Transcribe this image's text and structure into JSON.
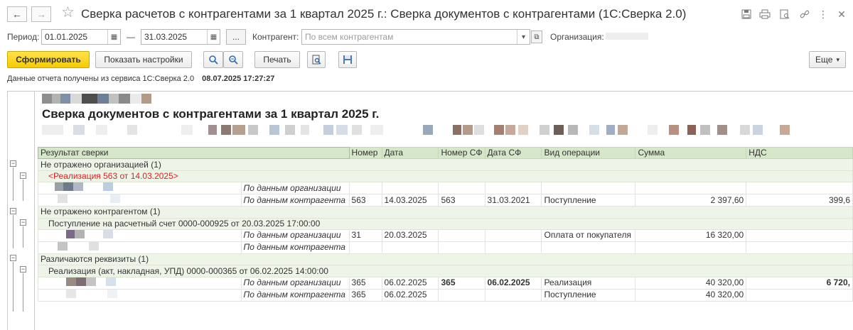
{
  "window": {
    "title": "Сверка расчетов с контрагентами за 1 квартал 2025 г.: Сверка документов с контрагентами (1С:Сверка 2.0)",
    "back_icon": "arrow-left-icon",
    "forward_icon": "arrow-right-icon",
    "favorite_icon": "star-icon",
    "tools": [
      "save-icon",
      "print-icon",
      "preview-icon",
      "link-icon",
      "more-icon",
      "close-icon"
    ]
  },
  "filters": {
    "period_label": "Период:",
    "date_from": "01.01.2025",
    "dash": "—",
    "date_to": "31.03.2025",
    "ellipsis": "...",
    "counterparty_label": "Контрагент:",
    "counterparty_placeholder": "По всем контрагентам",
    "organization_label": "Организация:"
  },
  "toolbar": {
    "generate": "Сформировать",
    "show_settings": "Показать настройки",
    "print": "Печать",
    "more": "Еще"
  },
  "status": {
    "text": "Данные отчета получены из сервиса 1С:Сверка 2.0",
    "timestamp": "08.07.2025 17:27:27"
  },
  "report": {
    "title": "Сверка документов с контрагентами за 1 квартал 2025 г.",
    "columns": [
      "Результат сверки",
      "Номер",
      "Дата",
      "Номер СФ",
      "Дата СФ",
      "Вид операции",
      "Сумма",
      "НДС"
    ],
    "groups": [
      {
        "label": "Не отражено организацией (1)",
        "document": "<Реализация 563 от 14.03.2025>",
        "rows": [
          {
            "source": "По данным организации",
            "number": "",
            "date": "",
            "sf_number": "",
            "sf_date": "",
            "operation": "",
            "sum": "",
            "vat": ""
          },
          {
            "source": "По данным контрагента",
            "number": "563",
            "date": "14.03.2025",
            "sf_number": "563",
            "sf_date": "31.03.2021",
            "operation": "Поступление",
            "sum": "2 397,60",
            "vat": "399,6"
          }
        ]
      },
      {
        "label": "Не отражено контрагентом (1)",
        "document": "Поступление на расчетный счет 0000-000925 от 20.03.2025 17:00:00",
        "rows": [
          {
            "source": "По данным организации",
            "number": "31",
            "date": "20.03.2025",
            "sf_number": "",
            "sf_date": "",
            "operation": "Оплата от покупателя",
            "sum": "16 320,00",
            "vat": ""
          },
          {
            "source": "По данным контрагента",
            "number": "",
            "date": "",
            "sf_number": "",
            "sf_date": "",
            "operation": "",
            "sum": "",
            "vat": ""
          }
        ]
      },
      {
        "label": "Различаются реквизиты (1)",
        "document": "Реализация (акт, накладная, УПД) 0000-000365 от 06.02.2025 14:00:00",
        "rows": [
          {
            "source": "По данным организации",
            "number": "365",
            "date": "06.02.2025",
            "sf_number": "365",
            "sf_date": "06.02.2025",
            "operation": "Реализация",
            "sum": "40 320,00",
            "vat": "6 720,"
          },
          {
            "source": "По данным контрагента",
            "number": "365",
            "date": "06.02.2025",
            "sf_number": "",
            "sf_date": "",
            "operation": "Поступление",
            "sum": "40 320,00",
            "vat": ""
          }
        ]
      }
    ]
  },
  "colors": {
    "primary_button": "#f5cc00",
    "header_row": "#d6e6c8",
    "group_row": "#eef5e8",
    "missing_document": "#e02020"
  }
}
